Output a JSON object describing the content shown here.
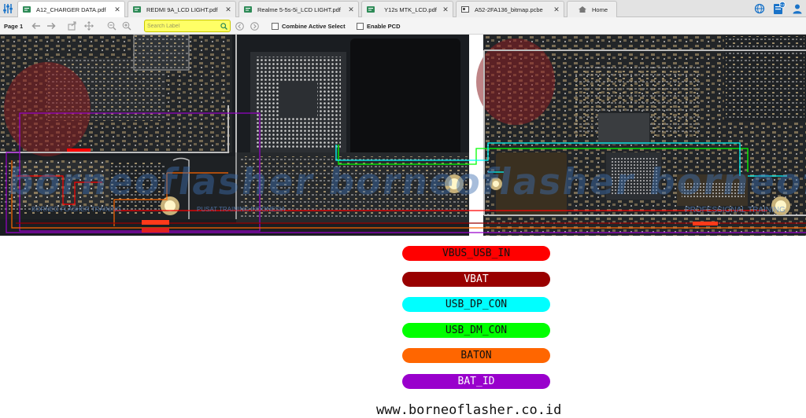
{
  "tabs": [
    {
      "label": "A12_CHARGER DATA.pdf",
      "active": true,
      "type": "pdf"
    },
    {
      "label": "REDMI 9A_LCD LIGHT.pdf",
      "active": false,
      "type": "pdf"
    },
    {
      "label": "Realme 5-5s-5i_LCD LIGHT.pdf",
      "active": false,
      "type": "pdf"
    },
    {
      "label": "Y12s MTK_LCD.pdf",
      "active": false,
      "type": "pdf"
    },
    {
      "label": "A52-2FA136_bitmap.pcbe",
      "active": false,
      "type": "pcbe"
    }
  ],
  "home_tab": {
    "label": "Home"
  },
  "toolbar": {
    "page_label": "Page 1",
    "search_placeholder": "Search Label",
    "combine_label": "Combine Active Select",
    "enable_pcd_label": "Enable PCD"
  },
  "board": {
    "watermark": "borneoflasher borneoflasher borneofl",
    "overlay_left": "BORNEO FLASHER TRAINING",
    "overlay_mid": "PUSAT TRAINING INDONESIA",
    "overlay_right": "PROFESSIONAL TRAINING"
  },
  "legend": [
    {
      "label": "VBUS_USB_IN",
      "color": "#ff0000"
    },
    {
      "label": "VBAT",
      "color": "#990000"
    },
    {
      "label": "USB_DP_CON",
      "color": "#00ffff"
    },
    {
      "label": "USB_DM_CON",
      "color": "#00ff00"
    },
    {
      "label": "BATON",
      "color": "#ff6600"
    },
    {
      "label": "BAT_ID",
      "color": "#9900cc"
    }
  ],
  "website": "www.borneoflasher.co.id",
  "colors": {
    "accent_blue": "#1a73c8",
    "search_bg": "#ffff66",
    "board_bg": "#181b1e"
  }
}
